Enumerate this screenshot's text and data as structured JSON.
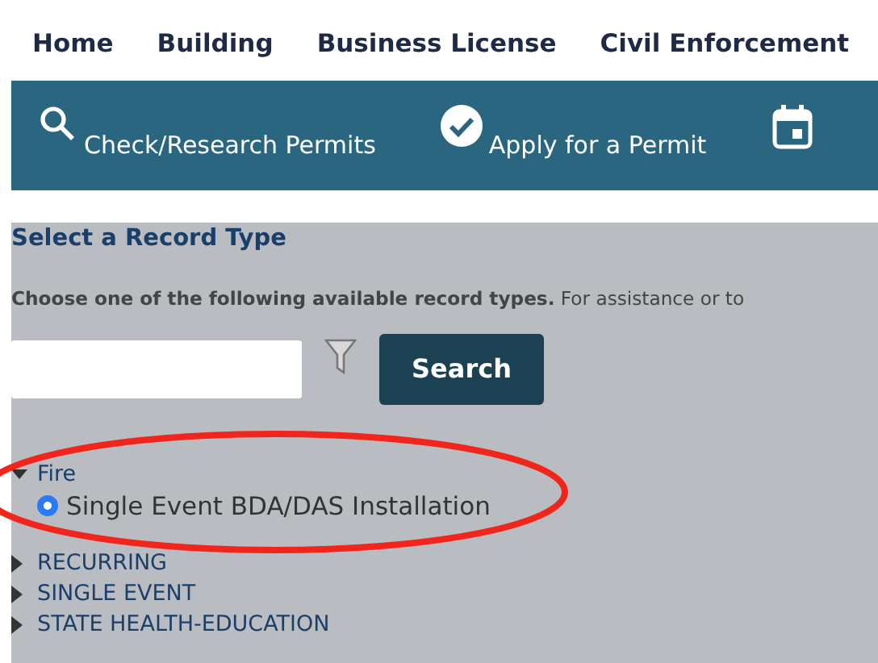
{
  "nav": [
    {
      "label": "Home"
    },
    {
      "label": "Building"
    },
    {
      "label": "Business License"
    },
    {
      "label": "Civil Enforcement"
    }
  ],
  "toolbar": [
    {
      "kind": "search",
      "label": "Check/Research Permits"
    },
    {
      "kind": "check",
      "label": "Apply for a Permit"
    },
    {
      "kind": "calendar"
    }
  ],
  "panel": {
    "title": "Select a Record Type",
    "description": "**Choose one of the following available record types.** For assistance or to",
    "search_button": "Search",
    "tree": [
      {
        "label": "Fire",
        "expanded": true,
        "children": [
          {
            "label": "Single Event BDA/DAS Installation",
            "selected": true
          }
        ]
      },
      {
        "label": "RECURRING",
        "expanded": false
      },
      {
        "label": "SINGLE EVENT",
        "expanded": false
      },
      {
        "label": "STATE HEALTH-EDUCATION",
        "expanded": false
      }
    ]
  }
}
